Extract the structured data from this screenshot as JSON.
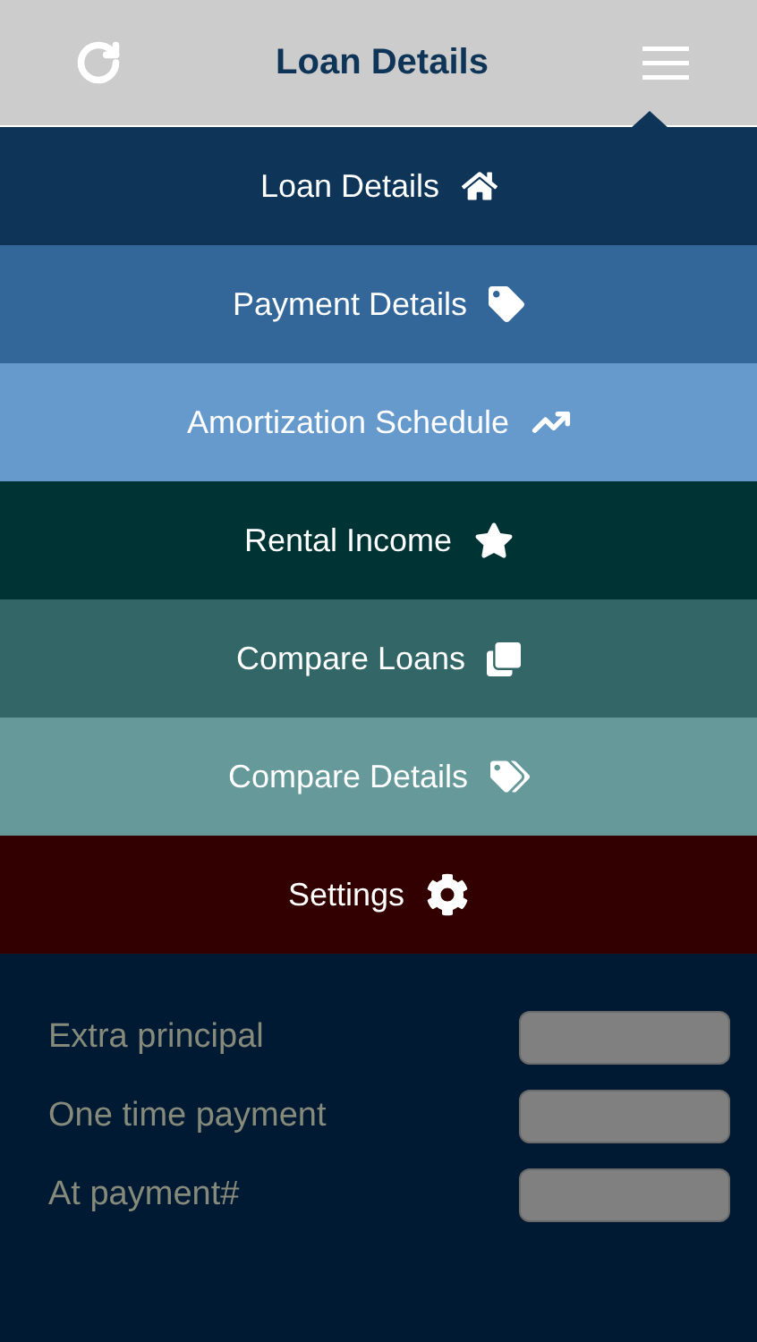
{
  "header": {
    "title": "Loan Details"
  },
  "menu": [
    {
      "label": "Loan Details",
      "color": "#0e3558"
    },
    {
      "label": "Payment Details",
      "color": "#336699"
    },
    {
      "label": "Amortization Schedule",
      "color": "#6699cc"
    },
    {
      "label": "Rental Income",
      "color": "#003333"
    },
    {
      "label": "Compare Loans",
      "color": "#336666"
    },
    {
      "label": "Compare Details",
      "color": "#669999"
    },
    {
      "label": "Settings",
      "color": "#330000"
    }
  ],
  "section": {
    "fields": [
      {
        "label": "Extra principal"
      },
      {
        "label": "One time payment"
      },
      {
        "label": "At payment#"
      }
    ]
  }
}
